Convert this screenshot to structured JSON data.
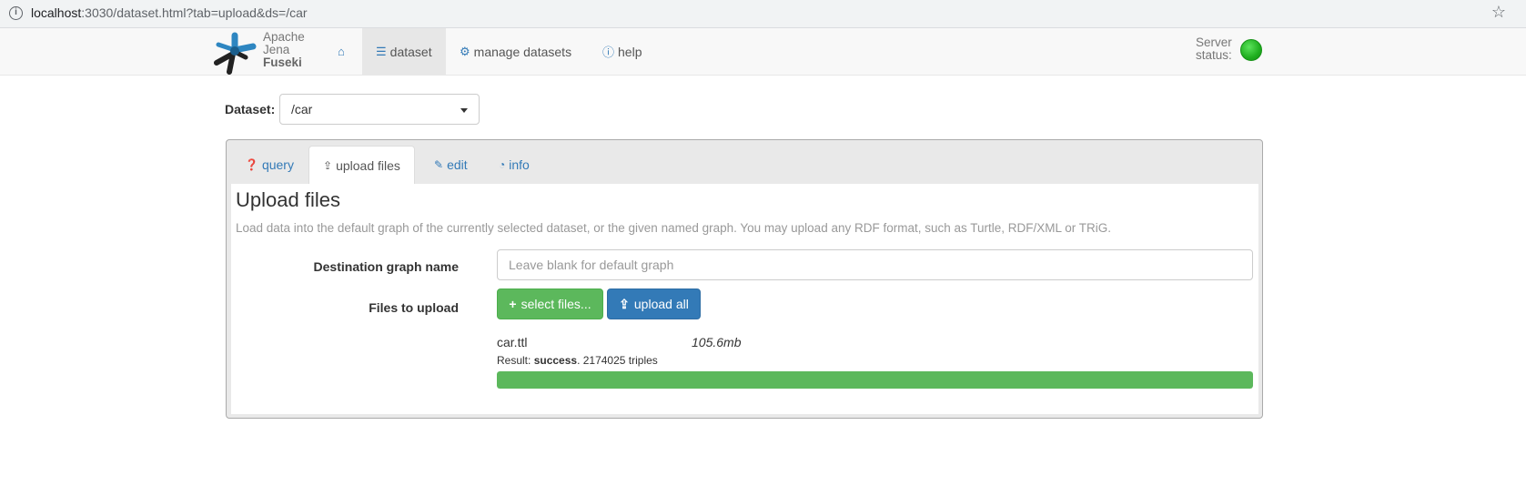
{
  "browser": {
    "url_host": "localhost",
    "url_rest": ":3030/dataset.html?tab=upload&ds=/car"
  },
  "navbar": {
    "logo_line1": "Apache",
    "logo_line2": "Jena",
    "logo_line3": "Fuseki",
    "items": [
      {
        "label": "",
        "icon": "home-icon"
      },
      {
        "label": "dataset",
        "icon": "database-icon"
      },
      {
        "label": "manage datasets",
        "icon": "cogs-icon"
      },
      {
        "label": "help",
        "icon": "info-icon"
      }
    ],
    "server_status_line1": "Server",
    "server_status_line2": "status:",
    "server_status_color": "#1fae1f"
  },
  "dataset": {
    "label": "Dataset:",
    "selected": "/car"
  },
  "tabs": [
    {
      "label": "query",
      "icon": "question-circle-icon"
    },
    {
      "label": "upload files",
      "icon": "upload-icon"
    },
    {
      "label": "edit",
      "icon": "edit-icon"
    },
    {
      "label": "info",
      "icon": "dashboard-icon"
    }
  ],
  "upload": {
    "title": "Upload files",
    "description": "Load data into the default graph of the currently selected dataset, or the given named graph. You may upload any RDF format, such as Turtle, RDF/XML or TRiG.",
    "dest_label": "Destination graph name",
    "dest_placeholder": "Leave blank for default graph",
    "files_label": "Files to upload",
    "select_button": "select files...",
    "upload_button": "upload all",
    "file": {
      "name": "car.ttl",
      "size": "105.6mb",
      "result_prefix": "Result: ",
      "result_status": "success",
      "result_suffix": ". 2174025 triples",
      "progress_percent": 100
    }
  },
  "colors": {
    "accent": "#337ab7",
    "success": "#5cb85c"
  }
}
